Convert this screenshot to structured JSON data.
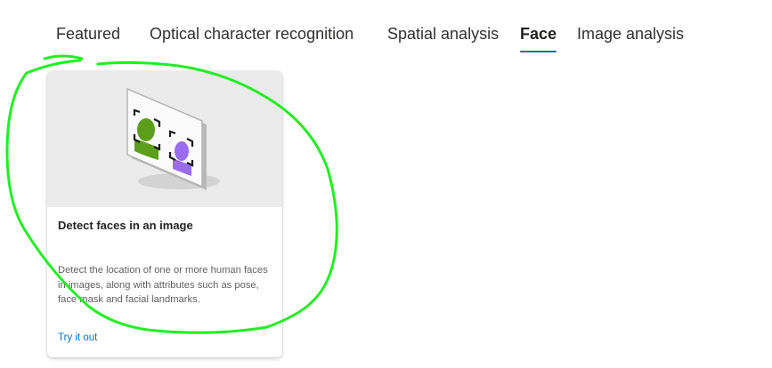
{
  "tabs": [
    {
      "label": "Featured",
      "active": false
    },
    {
      "label": "Optical character recognition",
      "active": false
    },
    {
      "label": "Spatial analysis",
      "active": false
    },
    {
      "label": "Face",
      "active": true
    },
    {
      "label": "Image analysis",
      "active": false
    }
  ],
  "card": {
    "illustration": "face-detection-illustration",
    "title": "Detect faces in an image",
    "description": "Detect the location of one or more human faces in images, along with attributes such as pose, face mask and facial landmarks.",
    "link": "Try it out"
  },
  "colors": {
    "accent": "#0f6cbd",
    "annotation": "#22ee22",
    "face_green": "#5c9e1a",
    "face_purple": "#9a6cf0"
  }
}
